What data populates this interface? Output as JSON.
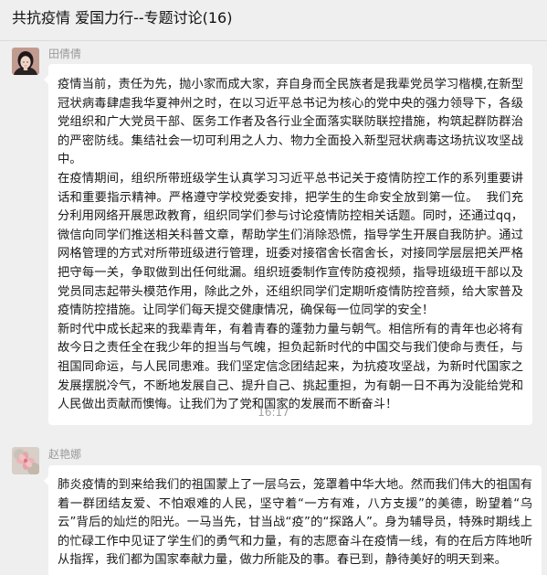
{
  "window": {
    "title": "共抗疫情  爱国力行--专题讨论(16)"
  },
  "messages": [
    {
      "sender": "田倩倩",
      "avatar_icon": "avatar-girl-portrait",
      "paragraphs": [
        "疫情当前，责任为先，抛小家而成大家，弃自身而全民族者是我辈党员学习楷模,在新型冠状病毒肆虐我华夏神州之时，在以习近平总书记为核心的党中央的强力领导下，各级党组织和广大党员干部、医务工作者及各行业全面落实联防联控措施，构筑起群防群治的严密防线。集结社会一切可利用之人力、物力全面投入新型冠状病毒这场抗议攻坚战中。",
        "在疫情期间，组织所带班级学生认真学习习近平总书记关于疫情防控工作的系列重要讲话和重要指示精神。严格遵守学校党委安排，把学生的生命安全放到第一位。  我们充分利用网络开展思政教育，组织同学们参与讨论疫情防控相关话题。同时，还通过qq，微信向同学们推送相关科普文章，帮助学生们消除恐慌，指导学生开展自我防护。通过网格管理的方式对所带班级进行管理，班委对接宿舍长宿舍长，对接同学层层把关严格把守每一关，争取做到出任何纰漏。组织班委制作宣传防疫视频，指导班级班干部以及党员同志起带头模范作用，除此之外，还组织同学们定期听疫情防控音频，给大家普及疫情防控措施。让同学们每天提交健康情况，确保每一位同学的安全！",
        "新时代中成长起来的我辈青年，有着青春的蓬勃力量与朝气。相信所有的青年也必将有故今日之责任全在我少年的担当与气魄，担负起新时代的中国交与我们使命与责任，与祖国同命运，与人民同患难。我们坚定信念团结起来，为抗疫攻坚战，为新时代国家之发展摆脱冷气，不断地发展自己、提升自己、挑起重担，为有朝一日不再为没能给党和人民做出贡献而懊悔。让我们为了党和国家的发展而不断奋斗！"
      ]
    },
    {
      "sender": "赵艳娜",
      "avatar_icon": "avatar-flower",
      "paragraphs": [
        "肺炎疫情的到来给我们的祖国蒙上了一层乌云，笼罩着中华大地。然而我们伟大的祖国有着一群团结友爱、不怕艰难的人民，坚守着“一方有难，八方支援”的美德，盼望着“乌云”背后的灿烂的阳光。一马当先，甘当战“疫”的“探路人”。身为辅导员，特殊时期线上的忙碌工作中见证了学生们的勇气和力量，有的志愿奋斗在疫情一线，有的在后方阵地听从指挥，我们都为国家奉献力量，做力所能及的事。春已到，静待美好的明天到来。"
      ]
    }
  ],
  "timestamp": "16:17",
  "colors": {
    "background": "#efefef",
    "bubble": "#ffffff",
    "sender_name": "#9a9a9a",
    "timestamp": "#a0a0a0"
  }
}
